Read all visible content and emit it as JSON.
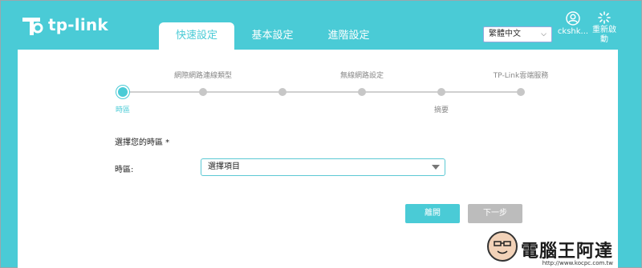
{
  "brand": {
    "logo_text": "tp-link"
  },
  "tabs": [
    {
      "label": "快速設定",
      "active": true
    },
    {
      "label": "基本設定",
      "active": false
    },
    {
      "label": "進階設定",
      "active": false
    }
  ],
  "language": {
    "selected": "繁體中文"
  },
  "account": {
    "label": "ckshk..."
  },
  "reboot": {
    "label": "重新啟動"
  },
  "wizard": {
    "steps_top": [
      "網際網路連線類型",
      "無線網路設定",
      "TP-Link雲端服務"
    ],
    "steps_bottom": [
      "時區",
      "摘要"
    ],
    "current_step": 1,
    "total_steps": 6
  },
  "form": {
    "section_title": "選擇您的時區 *",
    "timezone_label": "時區:",
    "timezone_value": "選擇項目"
  },
  "buttons": {
    "exit": "離開",
    "next": "下一步"
  },
  "watermark": {
    "text": "電腦王阿達",
    "url": "http://www.kocpc.com.tw"
  },
  "colors": {
    "accent": "#4acbd6",
    "disabled": "#bcbcbc"
  }
}
